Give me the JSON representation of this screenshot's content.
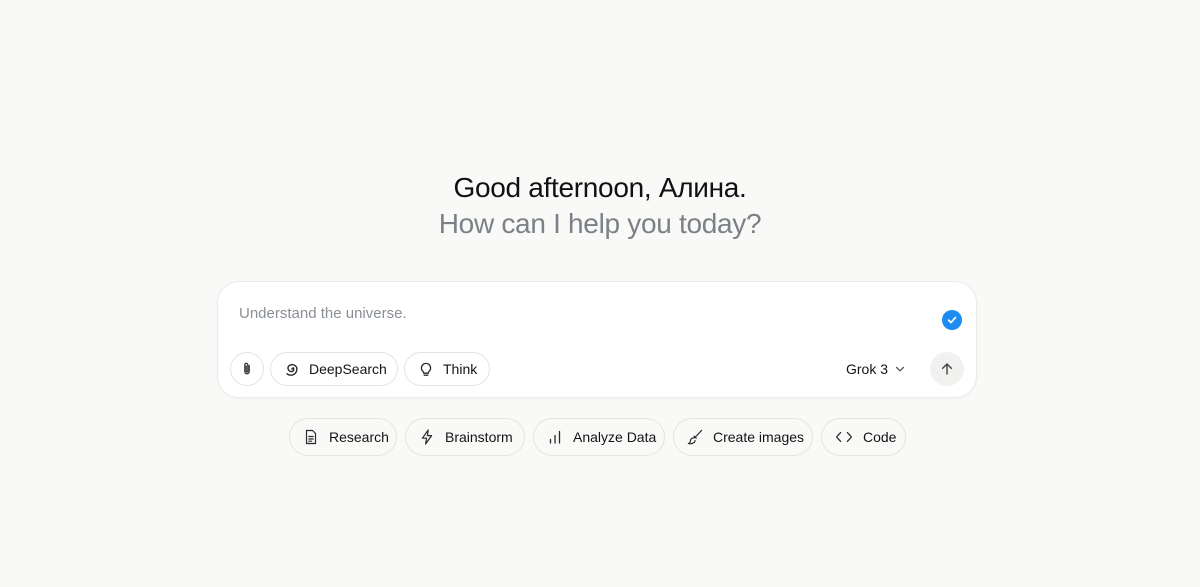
{
  "greeting": {
    "line1": "Good afternoon, Алина.",
    "line2": "How can I help you today?"
  },
  "composer": {
    "placeholder": "Understand the universe.",
    "value": "",
    "tools": [
      {
        "label": "DeepSearch",
        "icon": "deepsearch-icon"
      },
      {
        "label": "Think",
        "icon": "lightbulb-icon"
      }
    ],
    "attach_icon": "paperclip-icon",
    "model": {
      "label": "Grok 3",
      "icon": "chevron-down-icon"
    },
    "send_icon": "arrow-up-icon",
    "status_icon": "check-badge-icon"
  },
  "suggestions": [
    {
      "label": "Research",
      "icon": "document-icon"
    },
    {
      "label": "Brainstorm",
      "icon": "lightning-icon"
    },
    {
      "label": "Analyze Data",
      "icon": "bar-chart-icon"
    },
    {
      "label": "Create images",
      "icon": "paintbrush-icon"
    },
    {
      "label": "Code",
      "icon": "code-icon"
    }
  ],
  "colors": {
    "background": "#f9f9f8",
    "accent": "#1d8cf0",
    "muted_text": "#7c8187"
  }
}
